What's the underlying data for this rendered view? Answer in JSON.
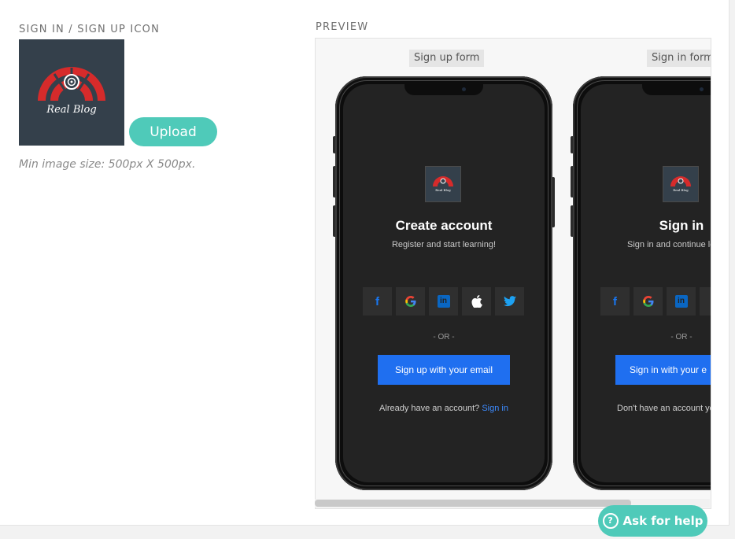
{
  "settings": {
    "icon_section_label": "SIGN IN / SIGN UP ICON",
    "upload_label": "Upload",
    "min_size_hint": "Min image size: 500px X 500px.",
    "logo_text": "Real Blog",
    "logo_mini_text": "Real Blog"
  },
  "preview": {
    "label": "PREVIEW",
    "signup": {
      "tag": "Sign up form",
      "title": "Create account",
      "subtitle": "Register and start learning!",
      "or_text": "- OR -",
      "email_button": "Sign up with your email",
      "footer_text": "Already have an account?",
      "footer_link": "Sign in"
    },
    "signin": {
      "tag": "Sign in form",
      "title": "Sign in",
      "subtitle": "Sign in and continue le",
      "or_text": "- OR -",
      "email_button": "Sign in with your e",
      "footer_text": "Don't have an account ye"
    },
    "social": [
      "f",
      "G",
      "in",
      "",
      ""
    ]
  },
  "help": {
    "label": "Ask for help",
    "icon": "?"
  },
  "colors": {
    "accent": "#4fcab9",
    "phone_screen": "#232323",
    "email_button": "#1f6ff0",
    "logo_bg": "#34404b",
    "logo_red": "#d62b2b"
  }
}
